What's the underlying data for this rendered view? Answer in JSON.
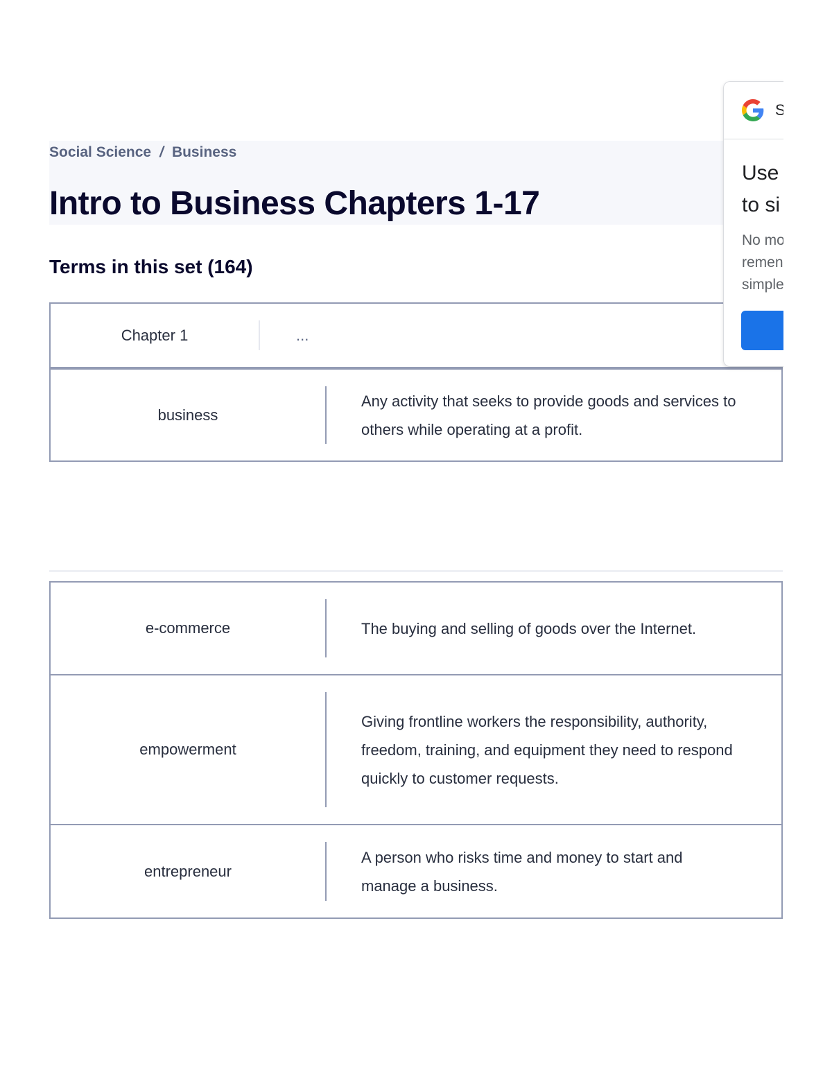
{
  "breadcrumb": {
    "items": [
      "Social Science",
      "Business"
    ],
    "separator": "/"
  },
  "title": "Intro to Business Chapters 1-17",
  "terms_heading": "Terms in this set (164)",
  "chapter_row": {
    "term": "Chapter 1",
    "definition": "..."
  },
  "cards": [
    {
      "term": "business",
      "definition": "Any activity that seeks to provide goods and services to others while operating at a profit."
    },
    {
      "term": "e-commerce",
      "definition": "The buying and selling of goods over the Internet."
    },
    {
      "term": "empowerment",
      "definition": "Giving frontline workers the responsibility, authority, freedom, training, and equipment they need to respond quickly to customer requests."
    },
    {
      "term": "entrepreneur",
      "definition": "A person who risks time and money to start and manage a business."
    }
  ],
  "google_popup": {
    "header_text": "S",
    "title_lines": [
      "Use",
      "to si"
    ],
    "body_lines": [
      "No mo",
      "remen",
      "simple"
    ],
    "colors": {
      "button": "#1a73e8"
    }
  },
  "colors": {
    "card_border": "#939bb4",
    "breadcrumb": "#586380",
    "title": "#0a092d"
  }
}
